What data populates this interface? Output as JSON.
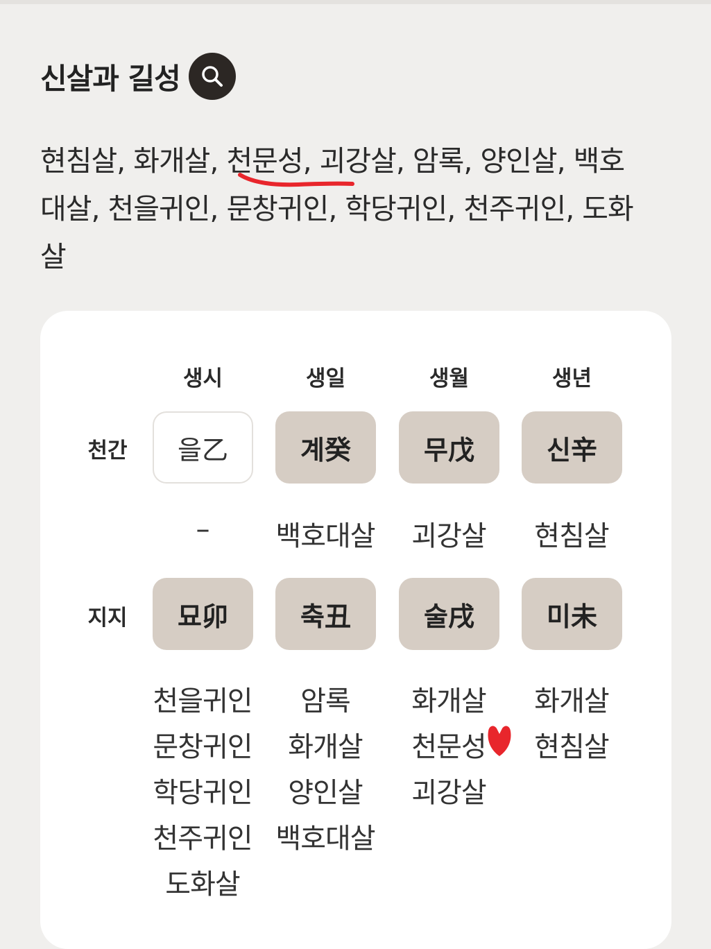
{
  "header": {
    "title": "신살과 길성",
    "search_icon": "search-icon"
  },
  "summary": {
    "items": [
      "현침살",
      "화개살",
      "천문성",
      "괴강살",
      "암록",
      "양인살",
      "백호대살",
      "천을귀인",
      "문창귀인",
      "학당귀인",
      "천주귀인",
      "도화살"
    ],
    "line1": "현침살, 화개살, 천문성, 괴강살, 암록, 양인살, 백호",
    "line2": "대살, 천을귀인, 문창귀인, 학당귀인, 천주귀인, 도화",
    "line3": "살"
  },
  "table": {
    "columns": [
      "생시",
      "생일",
      "생월",
      "생년"
    ],
    "rows": {
      "heavenly": {
        "label": "천간",
        "cells": [
          "을乙",
          "계癸",
          "무戊",
          "신辛"
        ],
        "sal": [
          "–",
          "백호대살",
          "괴강살",
          "현침살"
        ]
      },
      "earthly": {
        "label": "지지",
        "cells": [
          "묘卯",
          "축丑",
          "술戌",
          "미未"
        ],
        "sal": [
          [
            "천을귀인",
            "문창귀인",
            "학당귀인",
            "천주귀인",
            "도화살"
          ],
          [
            "암록",
            "화개살",
            "양인살",
            "백호대살"
          ],
          [
            "화개살",
            "천문성",
            "괴강살"
          ],
          [
            "화개살",
            "현침살"
          ]
        ]
      }
    }
  },
  "colors": {
    "cell_bg": "#d6cdc4",
    "card_bg": "#ffffff",
    "page_bg": "#f0efed",
    "search_button_bg": "#2c2724",
    "annotation_red": "#e8262c"
  }
}
